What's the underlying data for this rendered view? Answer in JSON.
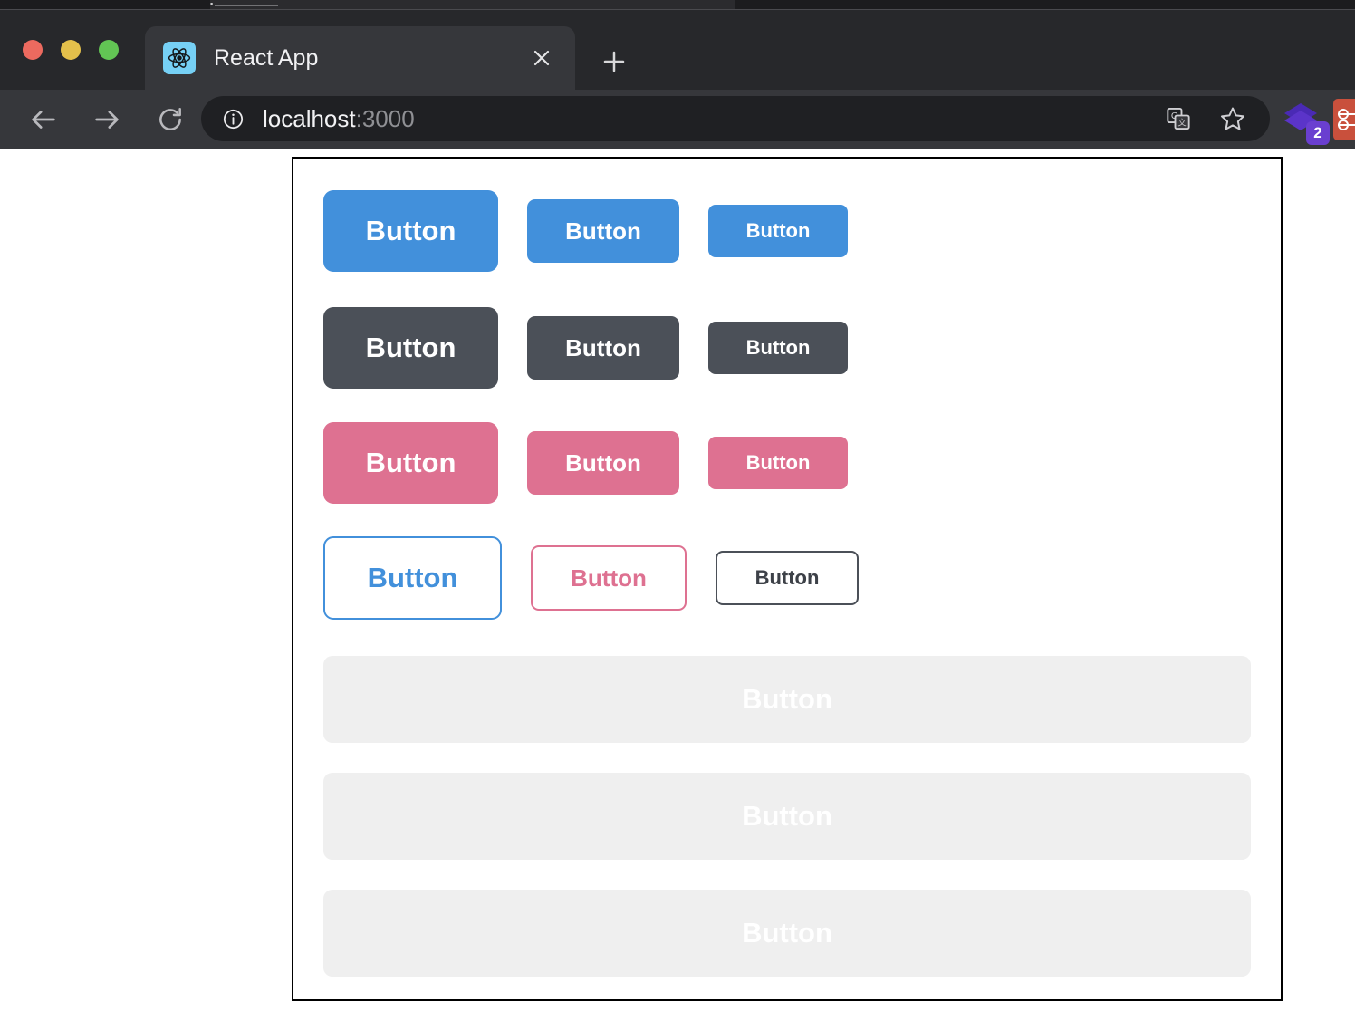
{
  "background_window": {
    "left_text": "",
    "tabstrip_text": "▪ ..................................."
  },
  "browser": {
    "traffic_lights": {
      "close_label": "close-window",
      "minimize_label": "minimize-window",
      "maximize_label": "maximize-window"
    },
    "tab": {
      "title": "React App",
      "favicon_name": "react-logo-icon",
      "close_label": "✕"
    },
    "new_tab_label": "+",
    "nav": {
      "back_label": "←",
      "forward_label": "→",
      "reload_label": "⟳"
    },
    "omnibox": {
      "site_info_icon": "info-circle-icon",
      "url_host": "localhost",
      "url_port": ":3000",
      "translate_icon": "translate-icon",
      "bookmark_icon": "star-icon"
    },
    "extensions": [
      {
        "name": "purple-layers-extension",
        "badge": "2",
        "color": "#5b34c9"
      },
      {
        "name": "red-extension",
        "badge": "",
        "color": "#c9503c"
      }
    ]
  },
  "colors": {
    "primary": "#4290db",
    "dark": "#4b5058",
    "pink": "#de7191",
    "frame_border": "#000000",
    "page_background": "#ffffff"
  },
  "page": {
    "rows": [
      {
        "name": "primary-buttons-row",
        "variant": "primary",
        "buttons": [
          {
            "label": "Button",
            "size": "lg"
          },
          {
            "label": "Button",
            "size": "md"
          },
          {
            "label": "Button",
            "size": "sm"
          }
        ]
      },
      {
        "name": "dark-buttons-row",
        "variant": "dark",
        "buttons": [
          {
            "label": "Button",
            "size": "lg"
          },
          {
            "label": "Button",
            "size": "md"
          },
          {
            "label": "Button",
            "size": "sm"
          }
        ]
      },
      {
        "name": "pink-buttons-row",
        "variant": "pink",
        "buttons": [
          {
            "label": "Button",
            "size": "lg"
          },
          {
            "label": "Button",
            "size": "md"
          },
          {
            "label": "Button",
            "size": "sm"
          }
        ]
      },
      {
        "name": "outline-buttons-row",
        "variant": "outline",
        "buttons": [
          {
            "label": "Button",
            "size": "lg",
            "outline_color": "primary"
          },
          {
            "label": "Button",
            "size": "md",
            "outline_color": "pink"
          },
          {
            "label": "Button",
            "size": "sm",
            "outline_color": "dark"
          }
        ]
      }
    ],
    "block_buttons": [
      {
        "label": "Button",
        "variant": "primary"
      },
      {
        "label": "Button",
        "variant": "pink"
      },
      {
        "label": "Button",
        "variant": "dark"
      }
    ]
  }
}
